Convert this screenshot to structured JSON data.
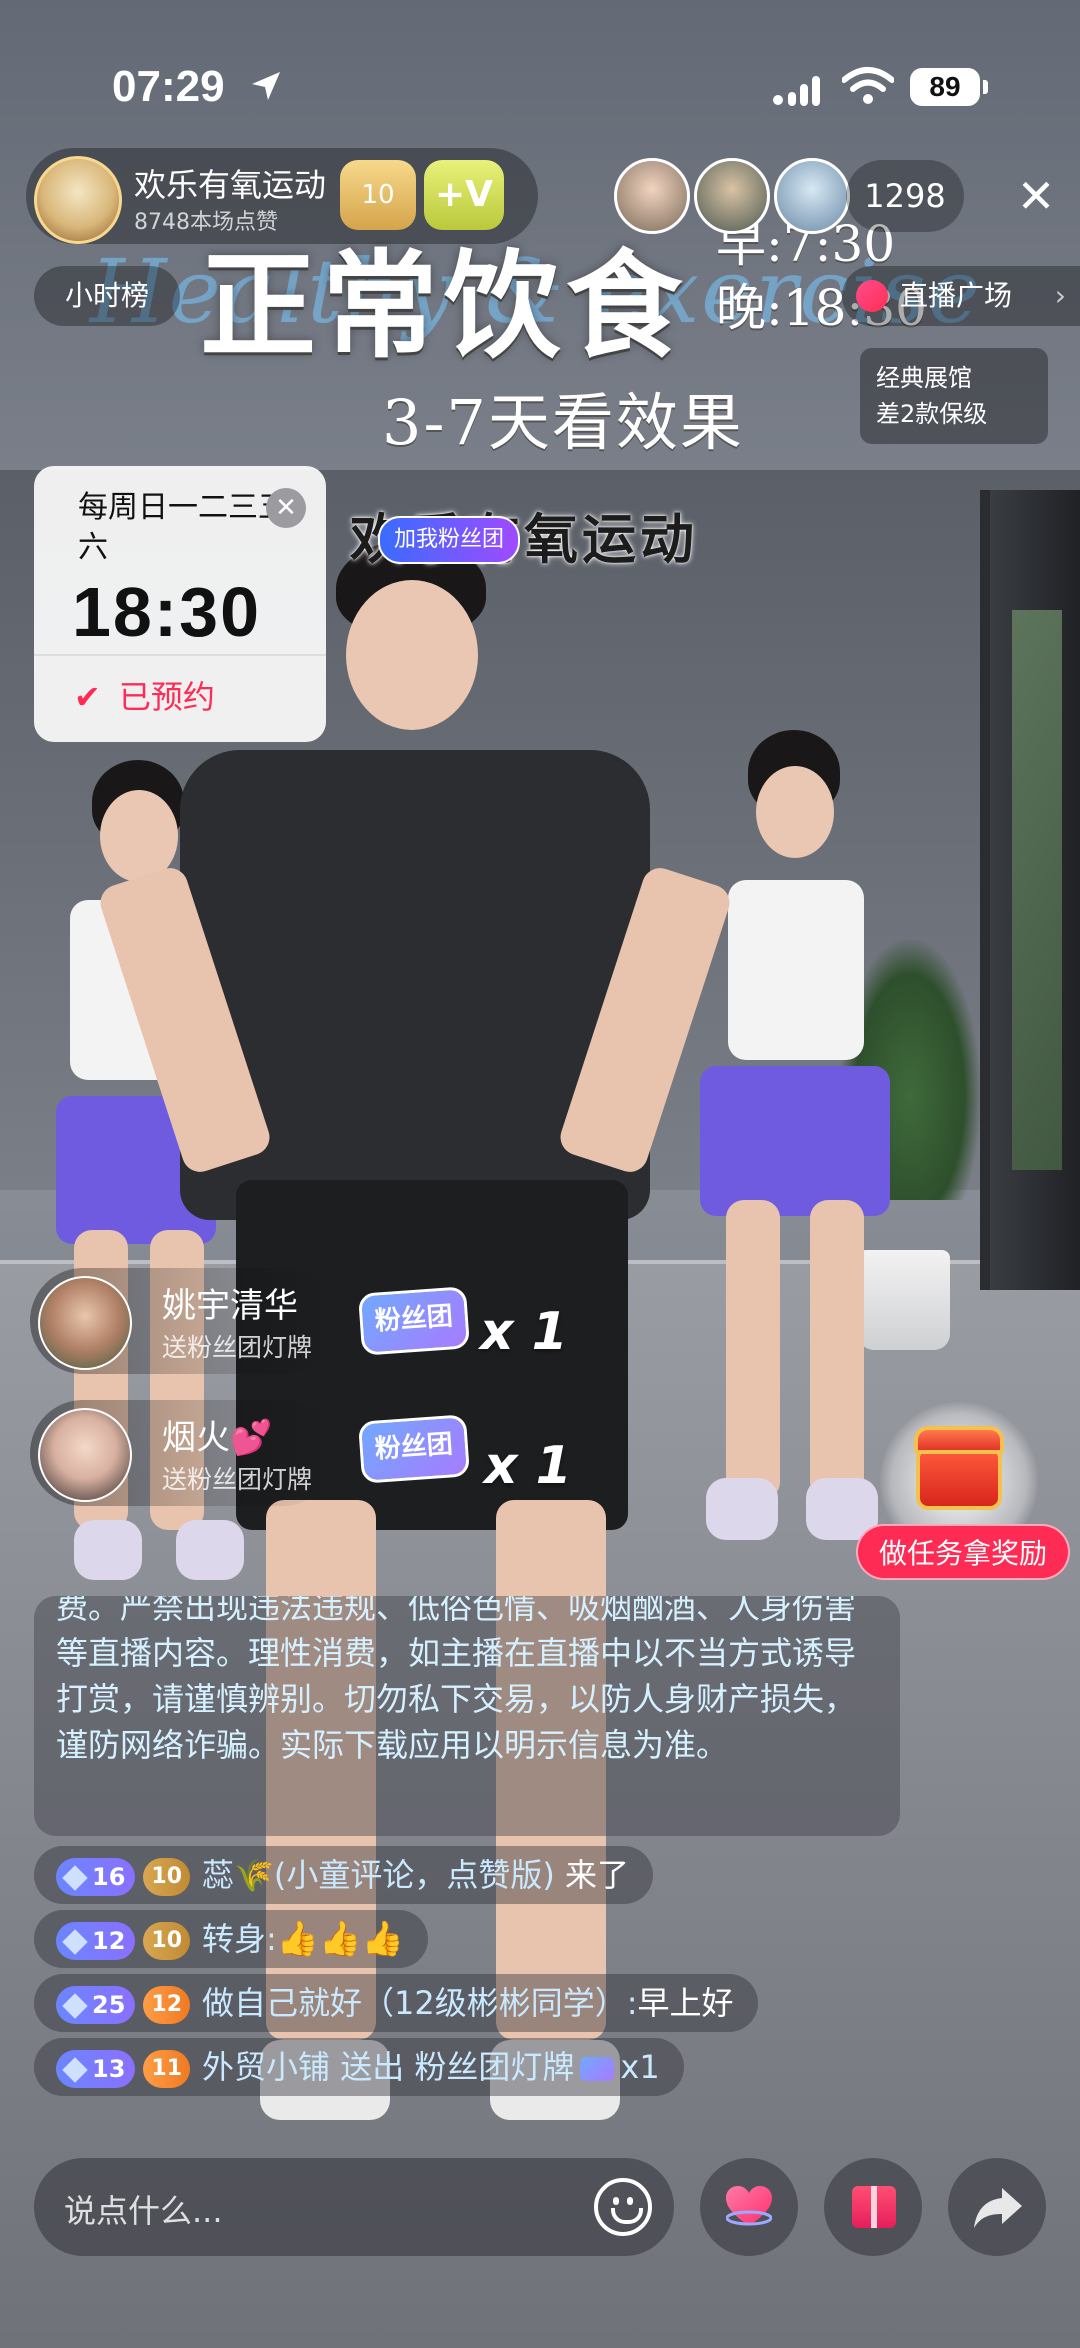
{
  "status_bar": {
    "time": "07:29",
    "battery": "89"
  },
  "host": {
    "name": "欢乐有氧运动",
    "likes": "8748本场点赞",
    "fan_level": "10",
    "badge": "+V"
  },
  "viewers": {
    "count": "1298"
  },
  "top_tags": {
    "hour_rank": "小时榜",
    "square": "直播广场",
    "gallery_line1": "经典展馆",
    "gallery_line2": "差2款保级"
  },
  "stream_overlay": {
    "title": "正常饮食",
    "script": "Healthy & exercise",
    "time_morning": "早:7:30",
    "time_evening": "晚:18:30",
    "subtitle": "3-7天看效果",
    "wall_sign": "欢乐有氧运动",
    "head_badge": "加我粉丝团"
  },
  "schedule": {
    "days": "每周日一二三五六",
    "time": "18:30",
    "status": "已预约"
  },
  "gift_combos": [
    {
      "user": "姚宇清华",
      "desc": "送粉丝团灯牌",
      "tag": "粉丝团",
      "count": "x 1"
    },
    {
      "user": "烟火💕",
      "desc": "送粉丝团灯牌",
      "tag": "粉丝团",
      "count": "x 1"
    }
  ],
  "task": {
    "label": "做任务拿奖励"
  },
  "notice": {
    "text": "费。严禁出现违法违规、低俗色情、吸烟酗酒、人身伤害等直播内容。理性消费，如主播在直播中以不当方式诱导打赏，请谨慎辨别。切勿私下交易，以防人身财产损失，谨防网络诈骗。实际下载应用以明示信息为准。"
  },
  "chat": [
    {
      "level": "16",
      "fan": "10",
      "name": "蕊🌾(小童评论，点赞版)",
      "text": "来了"
    },
    {
      "level": "12",
      "fan": "10",
      "name": "转身:",
      "text": "👍👍👍"
    },
    {
      "level": "25",
      "fan": "12",
      "name": "做自己就好（12级彬彬同学）:",
      "text": "早上好"
    },
    {
      "level": "13",
      "fan": "11",
      "name": "外贸小铺",
      "text": "送出 粉丝团灯牌",
      "count": "x1"
    }
  ],
  "input": {
    "placeholder": "说点什么..."
  },
  "icons": {
    "location": "location-arrow-icon",
    "signal": "signal-icon",
    "wifi": "wifi-icon",
    "close": "close-icon",
    "emoji": "emoji-icon",
    "like": "heart-icon",
    "gift": "gift-icon",
    "share": "share-icon",
    "chest": "treasure-chest-icon"
  },
  "colors": {
    "accent": "#fe2c55",
    "chat_name": "#c9e9ff",
    "notice_text": "#d5f1ff"
  }
}
